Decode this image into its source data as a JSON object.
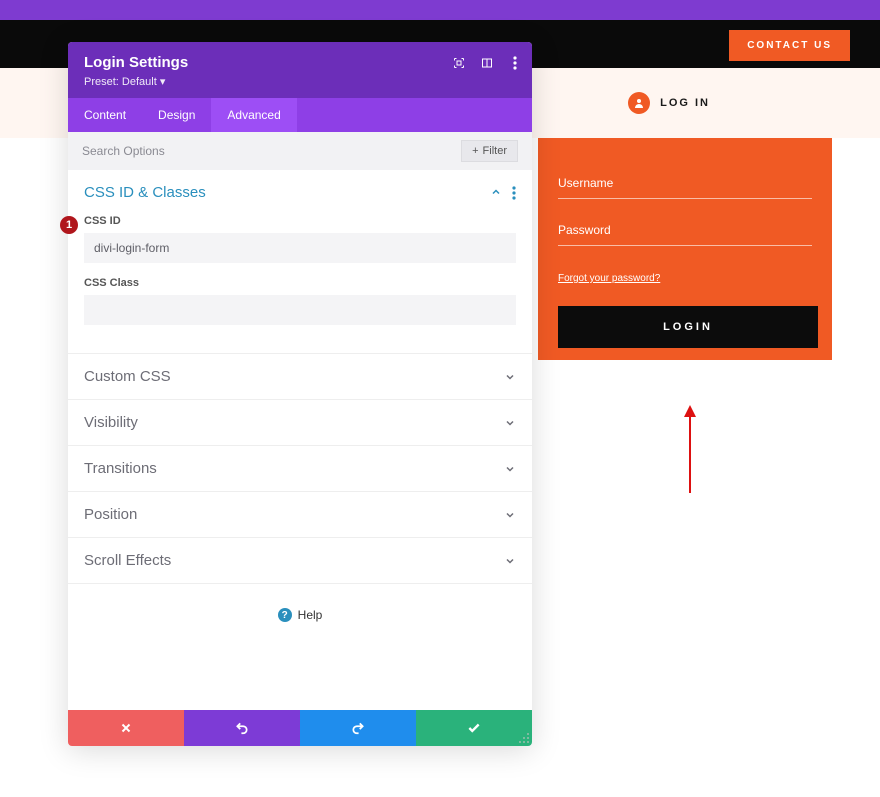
{
  "topbar": {
    "contact_label": "CONTACT US",
    "login_label": "LOG IN"
  },
  "login_form": {
    "username_label": "Username",
    "password_label": "Password",
    "forgot_label": "Forgot your password?",
    "submit_label": "LOGIN"
  },
  "panel": {
    "title": "Login Settings",
    "preset": "Preset: Default",
    "tabs": {
      "content": "Content",
      "design": "Design",
      "advanced": "Advanced"
    },
    "search_placeholder": "Search Options",
    "filter_label": "Filter",
    "css_section": {
      "title": "CSS ID & Classes",
      "id_label": "CSS ID",
      "id_value": "divi-login-form",
      "class_label": "CSS Class",
      "class_value": ""
    },
    "closed_sections": [
      "Custom CSS",
      "Visibility",
      "Transitions",
      "Position",
      "Scroll Effects"
    ],
    "help_label": "Help"
  },
  "marker": {
    "number": "1"
  }
}
